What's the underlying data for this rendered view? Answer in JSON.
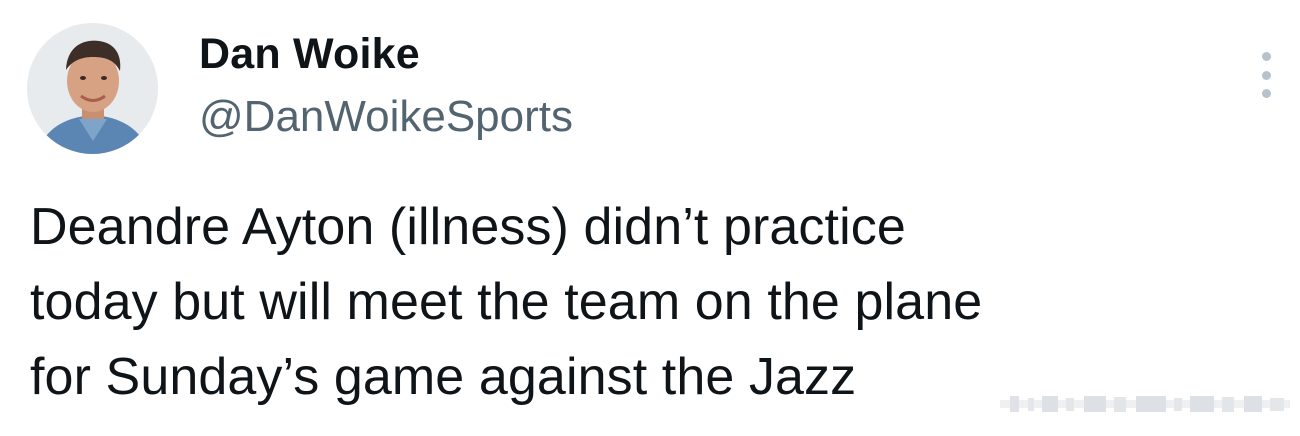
{
  "author": {
    "display_name": "Dan Woike",
    "handle": "@DanWoikeSports"
  },
  "tweet": {
    "lines": [
      "Deandre Ayton (illness) didn’t practice",
      "today but will meet the team on the plane",
      "for Sunday’s game against the Jazz"
    ]
  },
  "icons": {
    "menu": "more-vertical-icon"
  }
}
